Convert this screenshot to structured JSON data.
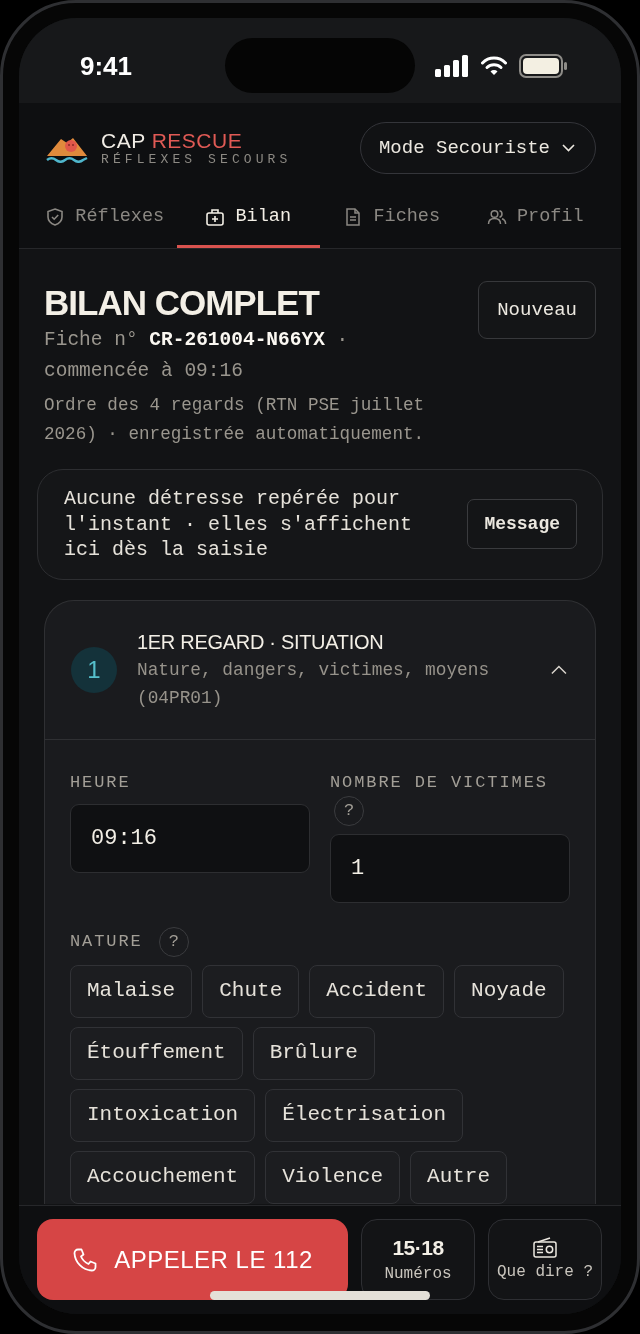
{
  "status_bar": {
    "time": "9:41"
  },
  "header": {
    "brand_name": "CAP",
    "brand_accent": "RESCUE",
    "tagline": "RÉFLEXES SECOURS",
    "mode_button": "Mode Secouriste"
  },
  "tabs": [
    {
      "label": "Réflexes",
      "selected": false
    },
    {
      "label": "Bilan",
      "selected": true
    },
    {
      "label": "Fiches",
      "selected": false
    },
    {
      "label": "Profil",
      "selected": false
    }
  ],
  "page": {
    "title": "BILAN COMPLET",
    "record": "Fiche n° **CR-261004-N66YX** · commencée à 09:16",
    "note": "Ordre des 4 regards (RTN PSE juillet 2026) · enregistrée automatiquement.",
    "new_button": "Nouveau"
  },
  "alert": {
    "message": "Aucune détresse repérée pour l'instant · elles s'affichent ici dès la saisie",
    "button": "Message"
  },
  "section": {
    "number": "1",
    "title": "1ER REGARD · SITUATION",
    "subtitle": "Nature, dangers, victimes, moyens (04PR01)",
    "expanded": true,
    "fields": [
      {
        "label": "HEURE",
        "value": "09:16"
      },
      {
        "label": "NOMBRE DE VICTIMES",
        "help": "?",
        "value": "1"
      }
    ],
    "nature": {
      "label": "NATURE",
      "help": "?",
      "chips": [
        {
          "label": "Malaise",
          "selected": false
        },
        {
          "label": "Chute",
          "selected": false
        },
        {
          "label": "Accident",
          "selected": false
        },
        {
          "label": "Noyade",
          "selected": false
        },
        {
          "label": "Étouffement",
          "selected": false
        },
        {
          "label": "Brûlure",
          "selected": false
        },
        {
          "label": "Intoxication",
          "selected": false
        },
        {
          "label": "Électrisation",
          "selected": false
        },
        {
          "label": "Accouchement",
          "selected": false
        },
        {
          "label": "Violence",
          "selected": false
        },
        {
          "label": "Autre",
          "selected": false
        }
      ]
    }
  },
  "bottom_bar": {
    "call_button": "APPELER LE 112",
    "numbers_button": {
      "number": "15·18",
      "label": "Numéros"
    },
    "phrases_button": "Que dire ?"
  }
}
